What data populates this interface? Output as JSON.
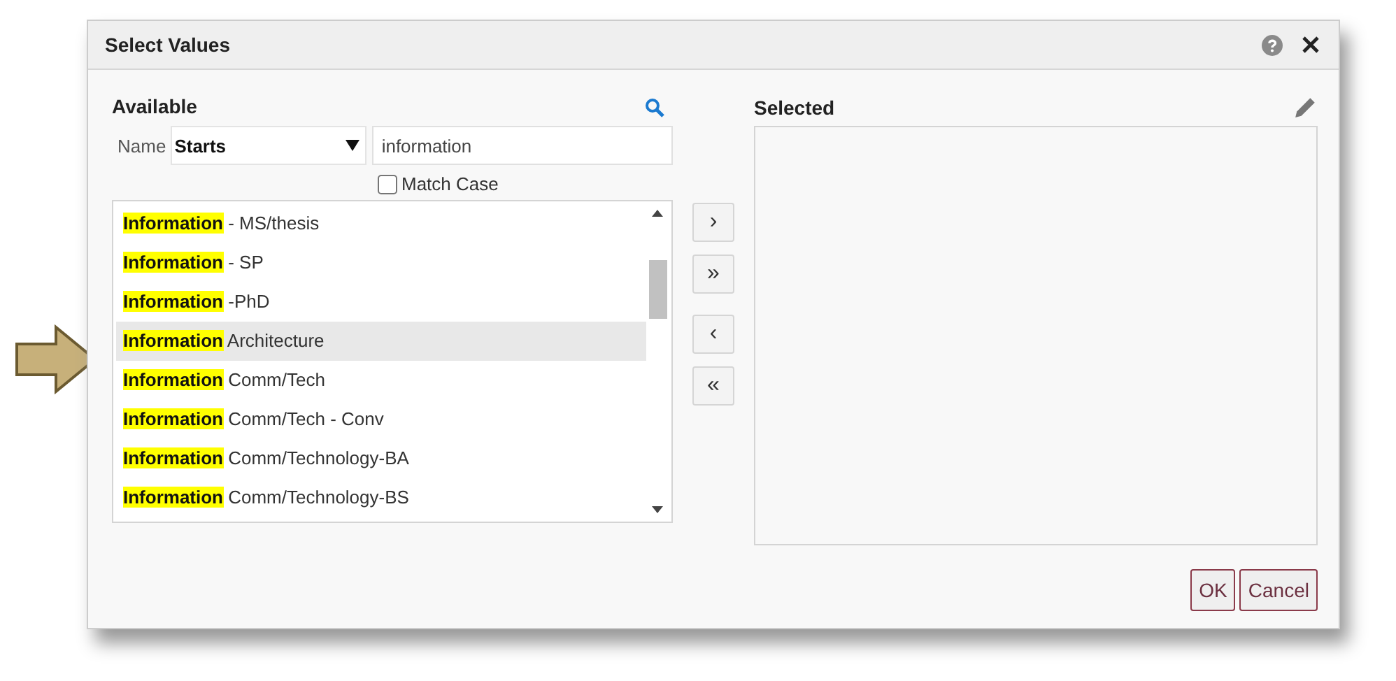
{
  "window": {
    "title": "Select Values"
  },
  "available": {
    "title": "Available",
    "filter_label": "Name",
    "operator": "Starts",
    "search": {
      "value": "information"
    },
    "match_case": {
      "label": "Match Case",
      "checked": false
    },
    "items": [
      {
        "match": "Information",
        "text": " - MS/thesis",
        "selected": false
      },
      {
        "match": "Information",
        "text": " - SP",
        "selected": false
      },
      {
        "match": "Information",
        "text": " -PhD",
        "selected": false
      },
      {
        "match": "Information",
        "text": " Architecture",
        "selected": true
      },
      {
        "match": "Information",
        "text": " Comm/Tech",
        "selected": false
      },
      {
        "match": "Information",
        "text": " Comm/Tech - Conv",
        "selected": false
      },
      {
        "match": "Information",
        "text": " Comm/Technology-BA",
        "selected": false
      },
      {
        "match": "Information",
        "text": " Comm/Technology-BS",
        "selected": false
      }
    ]
  },
  "move_buttons": [
    "›",
    "»",
    "‹",
    "«"
  ],
  "selected": {
    "title": "Selected"
  },
  "buttons": [
    "OK",
    "Cancel"
  ]
}
